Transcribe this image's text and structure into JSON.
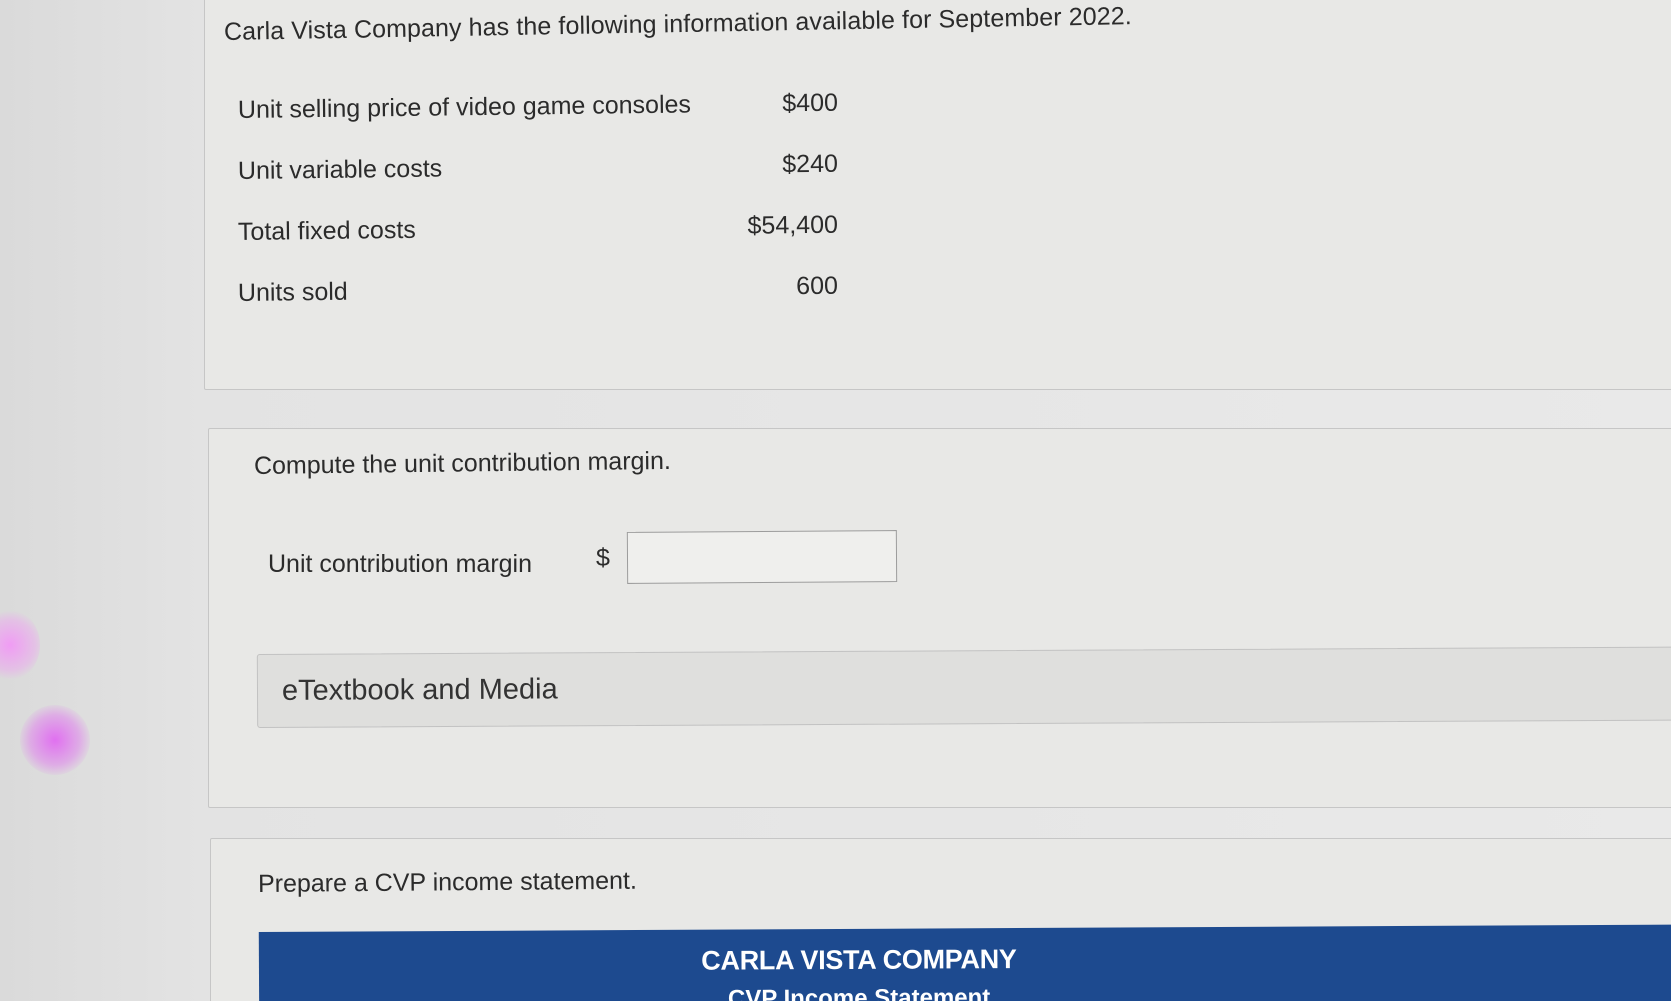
{
  "intro": "Carla Vista Company has the following information available for September 2022.",
  "info_rows": [
    {
      "label": "Unit selling price of video game consoles",
      "value": "$400"
    },
    {
      "label": "Unit variable costs",
      "value": "$240"
    },
    {
      "label": "Total fixed costs",
      "value": "$54,400"
    },
    {
      "label": "Units sold",
      "value": "600"
    }
  ],
  "question1": {
    "prompt": "Compute the unit contribution margin.",
    "field_label": "Unit contribution margin",
    "currency_symbol": "$",
    "input_value": ""
  },
  "etextbook_label": "eTextbook and Media",
  "question2": {
    "prompt": "Prepare a CVP income statement.",
    "statement_title": "CARLA VISTA COMPANY",
    "statement_subtitle": "CVP Income Statement"
  },
  "colors": {
    "banner": "#1d4a8f",
    "panel": "#e8e8e6"
  }
}
